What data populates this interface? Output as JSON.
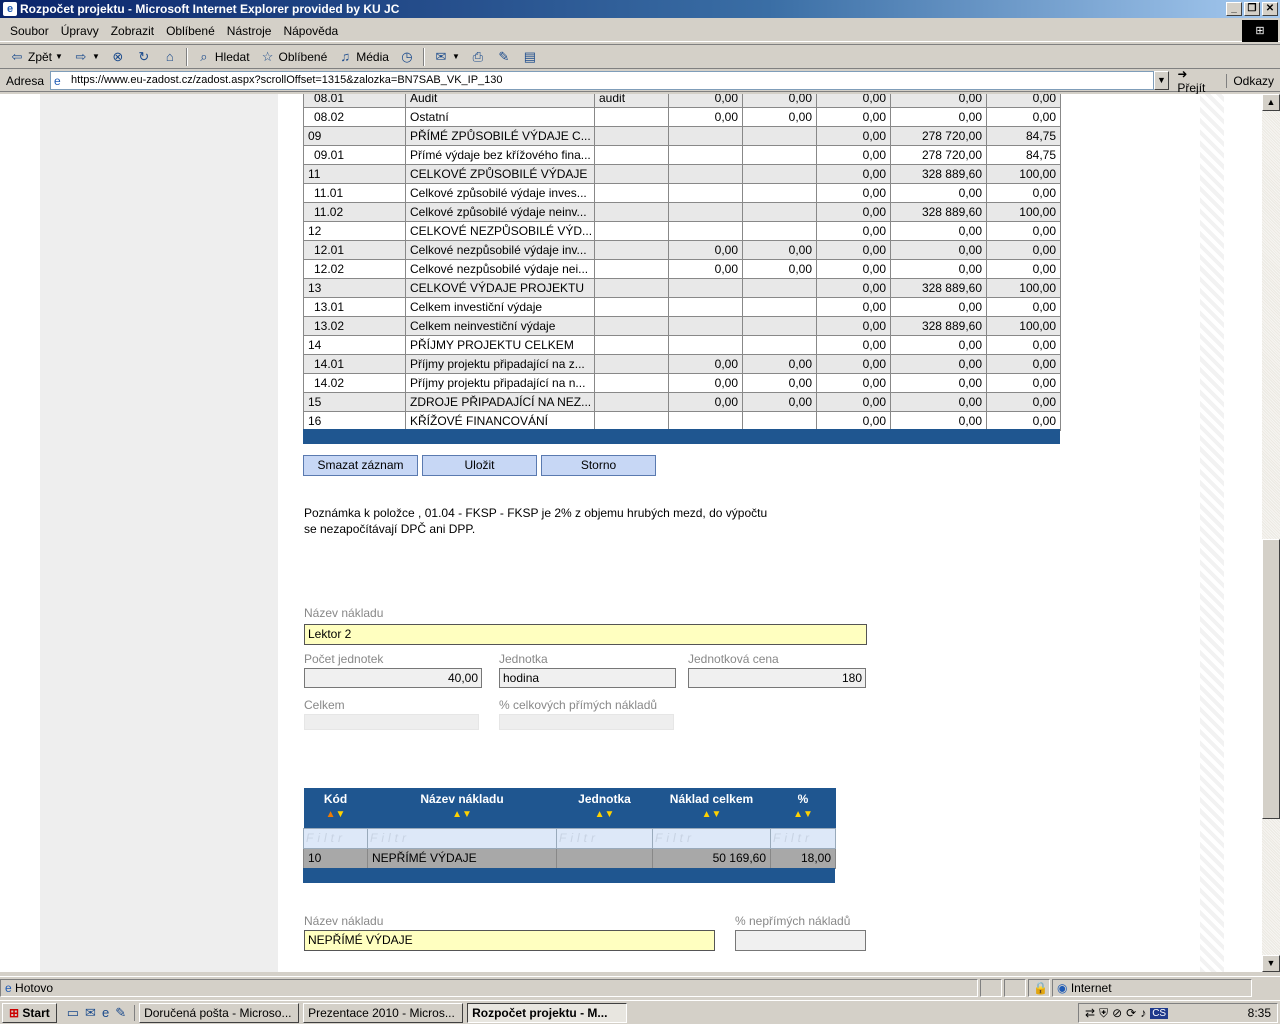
{
  "window": {
    "title": "Rozpočet projektu - Microsoft Internet Explorer provided by KU JC"
  },
  "menu": [
    "Soubor",
    "Úpravy",
    "Zobrazit",
    "Oblíbené",
    "Nástroje",
    "Nápověda"
  ],
  "toolbar": {
    "back": "Zpět",
    "search": "Hledat",
    "favorites": "Oblíbené",
    "media": "Média"
  },
  "address": {
    "label": "Adresa",
    "url": "https://www.eu-zadost.cz/zadost.aspx?scrollOffset=1315&zalozka=BN7SAB_VK_IP_130",
    "go": "Přejít",
    "links": "Odkazy"
  },
  "grid": {
    "rows": [
      {
        "code": "08.01",
        "name": "Audit",
        "unit": "audit",
        "c1": "0,00",
        "c2": "0,00",
        "c3": "0,00",
        "c4": "0,00",
        "c5": "0,00",
        "sub": true
      },
      {
        "code": "08.02",
        "name": "Ostatní",
        "unit": "",
        "c1": "0,00",
        "c2": "0,00",
        "c3": "0,00",
        "c4": "0,00",
        "c5": "0,00",
        "sub": true
      },
      {
        "code": "09",
        "name": "PŘÍMÉ ZPŮSOBILÉ VÝDAJE C...",
        "unit": "",
        "c1": "",
        "c2": "",
        "c3": "0,00",
        "c4": "278 720,00",
        "c5": "84,75",
        "sub": false
      },
      {
        "code": "09.01",
        "name": "Přímé výdaje bez křížového fina...",
        "unit": "",
        "c1": "",
        "c2": "",
        "c3": "0,00",
        "c4": "278 720,00",
        "c5": "84,75",
        "sub": true
      },
      {
        "code": "11",
        "name": "CELKOVÉ ZPŮSOBILÉ VÝDAJE",
        "unit": "",
        "c1": "",
        "c2": "",
        "c3": "0,00",
        "c4": "328 889,60",
        "c5": "100,00",
        "sub": false
      },
      {
        "code": "11.01",
        "name": "Celkové způsobilé výdaje inves...",
        "unit": "",
        "c1": "",
        "c2": "",
        "c3": "0,00",
        "c4": "0,00",
        "c5": "0,00",
        "sub": true
      },
      {
        "code": "11.02",
        "name": "Celkové způsobilé výdaje neinv...",
        "unit": "",
        "c1": "",
        "c2": "",
        "c3": "0,00",
        "c4": "328 889,60",
        "c5": "100,00",
        "sub": true
      },
      {
        "code": "12",
        "name": "CELKOVÉ NEZPŮSOBILÉ VÝD...",
        "unit": "",
        "c1": "",
        "c2": "",
        "c3": "0,00",
        "c4": "0,00",
        "c5": "0,00",
        "sub": false
      },
      {
        "code": "12.01",
        "name": "Celkové nezpůsobilé výdaje inv...",
        "unit": "",
        "c1": "0,00",
        "c2": "0,00",
        "c3": "0,00",
        "c4": "0,00",
        "c5": "0,00",
        "sub": true
      },
      {
        "code": "12.02",
        "name": "Celkové nezpůsobilé výdaje nei...",
        "unit": "",
        "c1": "0,00",
        "c2": "0,00",
        "c3": "0,00",
        "c4": "0,00",
        "c5": "0,00",
        "sub": true
      },
      {
        "code": "13",
        "name": "CELKOVÉ VÝDAJE PROJEKTU",
        "unit": "",
        "c1": "",
        "c2": "",
        "c3": "0,00",
        "c4": "328 889,60",
        "c5": "100,00",
        "sub": false
      },
      {
        "code": "13.01",
        "name": "Celkem investiční výdaje",
        "unit": "",
        "c1": "",
        "c2": "",
        "c3": "0,00",
        "c4": "0,00",
        "c5": "0,00",
        "sub": true
      },
      {
        "code": "13.02",
        "name": "Celkem neinvestiční výdaje",
        "unit": "",
        "c1": "",
        "c2": "",
        "c3": "0,00",
        "c4": "328 889,60",
        "c5": "100,00",
        "sub": true
      },
      {
        "code": "14",
        "name": "PŘÍJMY PROJEKTU CELKEM",
        "unit": "",
        "c1": "",
        "c2": "",
        "c3": "0,00",
        "c4": "0,00",
        "c5": "0,00",
        "sub": false
      },
      {
        "code": "14.01",
        "name": "Příjmy projektu připadající na z...",
        "unit": "",
        "c1": "0,00",
        "c2": "0,00",
        "c3": "0,00",
        "c4": "0,00",
        "c5": "0,00",
        "sub": true
      },
      {
        "code": "14.02",
        "name": "Příjmy projektu připadající na n...",
        "unit": "",
        "c1": "0,00",
        "c2": "0,00",
        "c3": "0,00",
        "c4": "0,00",
        "c5": "0,00",
        "sub": true
      },
      {
        "code": "15",
        "name": "ZDROJE PŘIPADAJÍCÍ NA NEZ...",
        "unit": "",
        "c1": "0,00",
        "c2": "0,00",
        "c3": "0,00",
        "c4": "0,00",
        "c5": "0,00",
        "sub": false
      },
      {
        "code": "16",
        "name": "KŘÍŽOVÉ FINANCOVÁNÍ",
        "unit": "",
        "c1": "",
        "c2": "",
        "c3": "0,00",
        "c4": "0,00",
        "c5": "0,00",
        "sub": false
      }
    ]
  },
  "actions": {
    "delete": "Smazat záznam",
    "save": "Uložit",
    "cancel": "Storno"
  },
  "note": {
    "line1": "Poznámka k položce , 01.04 - FKSP - FKSP je 2% z objemu hrubých mezd, do výpočtu",
    "line2": "se nezapočítávají DPČ ani DPP."
  },
  "form": {
    "name_label": "Název nákladu",
    "name_value": "Lektor 2",
    "count_label": "Počet jednotek",
    "count_value": "40,00",
    "unit_label": "Jednotka",
    "unit_value": "hodina",
    "unitprice_label": "Jednotková cena",
    "unitprice_value": "180",
    "total_label": "Celkem",
    "total_value": "",
    "pct_label": "% celkových přímých nákladů",
    "pct_value": ""
  },
  "subtable": {
    "headers": [
      "Kód",
      "Název nákladu",
      "Jednotka",
      "Náklad celkem",
      "%"
    ],
    "filter": "Filtr",
    "row": {
      "code": "10",
      "name": "NEPŘÍMÉ VÝDAJE",
      "unit": "",
      "total": "50 169,60",
      "pct": "18,00"
    }
  },
  "form2": {
    "name_label": "Název nákladu",
    "name_value": "NEPŘÍMÉ VÝDAJE",
    "pct_label": "% nepřímých nákladů",
    "pct_value": ""
  },
  "status": {
    "text": "Hotovo",
    "zone": "Internet"
  },
  "taskbar": {
    "start": "Start",
    "tasks": [
      "Doručená pošta - Microso...",
      "Prezentace 2010 - Micros...",
      "Rozpočet projektu - M..."
    ],
    "lang": "CS",
    "clock": "8:35"
  }
}
